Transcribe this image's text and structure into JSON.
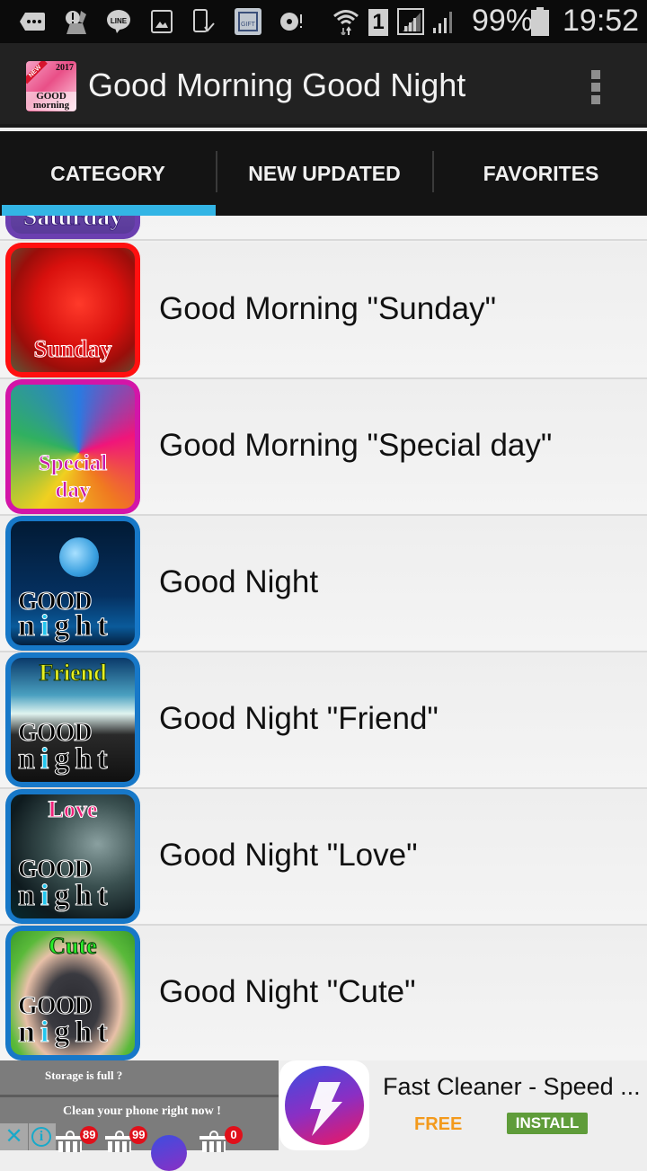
{
  "status_bar": {
    "notification_icons": [
      "more-icon",
      "alert-icon",
      "line-icon",
      "gallery-icon",
      "device-check-icon",
      "pocket-gift-icon",
      "disc-alert-icon"
    ],
    "wifi_icon": "wifi-icon",
    "sim_label": "1",
    "battery_percent": "99%",
    "time": "19:52"
  },
  "action_bar": {
    "app_icon": {
      "new_label": "NEW",
      "year": "2017",
      "line1": "GOOD",
      "line2": "morning"
    },
    "title": "Good Morning Good Night",
    "overflow_icon": "more-vert-icon"
  },
  "tabs": [
    {
      "label": "CATEGORY",
      "selected": true
    },
    {
      "label": "NEW UPDATED",
      "selected": false
    },
    {
      "label": "FAVORITES",
      "selected": false
    }
  ],
  "accent_color": "#33b5e5",
  "list": {
    "partial_top_item": {
      "thumb_caption": "Saturday"
    },
    "items": [
      {
        "label": "Good Morning \"Sunday\"",
        "thumb_caption": "Sunday",
        "thumb_theme": "red-tulip"
      },
      {
        "label": "Good Morning \"Special day\"",
        "thumb_caption_1": "Special",
        "thumb_caption_2": "day",
        "thumb_theme": "rainbow-rose"
      },
      {
        "label": "Good Night",
        "thumb_good": "GOOD",
        "thumb_night": [
          "n",
          "i",
          "g",
          "h",
          "t"
        ],
        "thumb_theme": "moon"
      },
      {
        "label": "Good Night \"Friend\"",
        "thumb_caption": "Friend",
        "thumb_good": "GOOD",
        "thumb_night": [
          "n",
          "i",
          "g",
          "h",
          "t"
        ],
        "thumb_theme": "friends-silhouette"
      },
      {
        "label": "Good Night \"Love\"",
        "thumb_caption": "Love",
        "thumb_good": "GOOD",
        "thumb_night": [
          "n",
          "i",
          "g",
          "h",
          "t"
        ],
        "thumb_theme": "couple-silhouette"
      },
      {
        "label": "Good Night \"Cute\"",
        "thumb_caption": "Cute",
        "thumb_good": "GOOD",
        "thumb_night": [
          "n",
          "i",
          "g",
          "h",
          "t"
        ],
        "thumb_theme": "puppy"
      }
    ]
  },
  "ad": {
    "headline": "Storage is full ?",
    "subline": "Clean your phone right now !",
    "close_icon": "close-icon",
    "info_icon": "info-icon",
    "trash_badges": [
      "89",
      "99",
      "0"
    ],
    "app_name": "Fast Cleaner - Speed ...",
    "price": "FREE",
    "install_label": "INSTALL"
  }
}
